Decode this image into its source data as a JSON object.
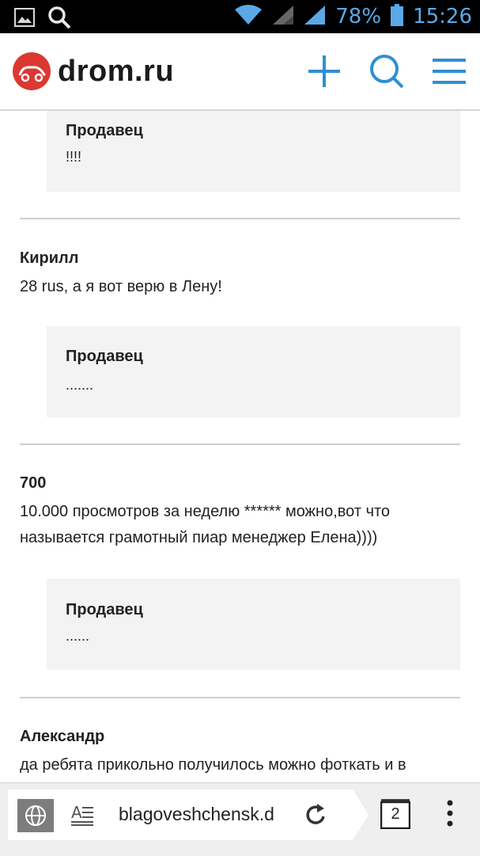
{
  "status_bar": {
    "battery": "78%",
    "time": "15:26"
  },
  "header": {
    "logo_text": "drom.ru",
    "icons": [
      "add-icon",
      "search-icon",
      "menu-icon"
    ]
  },
  "content": {
    "top_reply": {
      "title": "Продавец",
      "text": "!!!!"
    },
    "comments": [
      {
        "author": "Кирилл",
        "text": "28 rus, а я вот верю в Лену!",
        "reply": {
          "title": "Продавец",
          "text": "......."
        }
      },
      {
        "author": "700",
        "text": "10.000 просмотров за неделю ****** можно,вот что называется грамотный пиар менеджер Елена))))",
        "reply": {
          "title": "Продавец",
          "text": "......"
        }
      },
      {
        "author": "Александр",
        "text": "да ребята прикольно получилось можно фоткать и в"
      }
    ]
  },
  "browser_bar": {
    "url": "blagoveshchensk.d",
    "tab_count": "2"
  },
  "colors": {
    "accent_blue": "#2f8fd3",
    "logo_red": "#db3832",
    "status_blue": "#5aa9e6"
  }
}
